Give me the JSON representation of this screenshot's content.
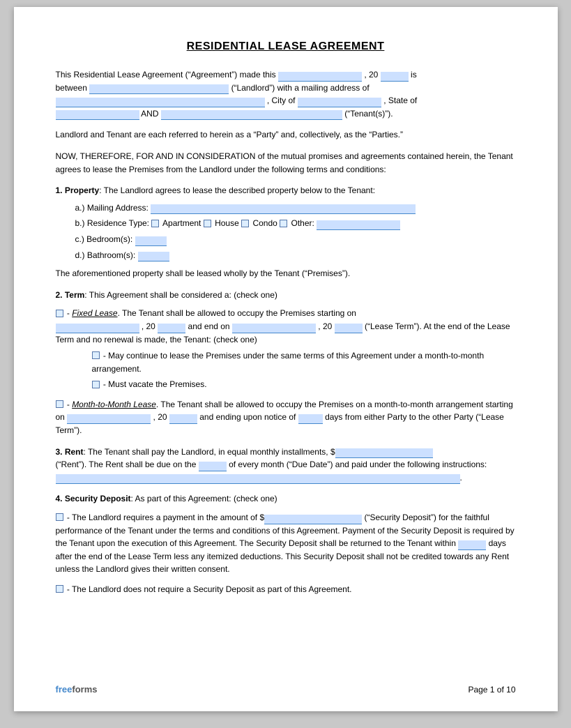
{
  "title": "RESIDENTIAL LEASE AGREEMENT",
  "intro": {
    "line1_pre": "This Residential Lease Agreement (“Agreement”) made this",
    "line1_mid": ", 20",
    "line1_post": "is",
    "line2_pre": "between",
    "line2_mid": "(“Landlord”) with a mailing address of",
    "line3_city_pre": ", City of",
    "line3_post": ", State of",
    "line4_and": "AND",
    "line4_post": "(“Tenant(s)”)."
  },
  "parties_note": "Landlord and Tenant are each referred to herein as a “Party” and, collectively, as the “Parties.”",
  "consideration": "NOW, THEREFORE, FOR AND IN CONSIDERATION of the mutual promises and agreements contained herein, the Tenant agrees to lease the Premises from the Landlord under the following terms and conditions:",
  "section1": {
    "heading": "1. Property",
    "text": ": The Landlord agrees to lease the described property below to the Tenant:",
    "a_label": "a.)  Mailing Address:",
    "b_label": "b.)  Residence Type:",
    "b_options": [
      "Apartment",
      "House",
      "Condo",
      "Other:"
    ],
    "c_label": "c.)  Bedroom(s):",
    "d_label": "d.)  Bathroom(s):",
    "footer_text": "The aforementioned property shall be leased wholly by the Tenant (“Premises”)."
  },
  "section2": {
    "heading": "2. Term",
    "text": ": This Agreement shall be considered a: (check one)",
    "fixed_label": "- ",
    "fixed_italic": "Fixed Lease",
    "fixed_text": ". The Tenant shall be allowed to occupy the Premises starting on",
    "fixed_text2": ", 20",
    "fixed_text3": "and end on",
    "fixed_text4": ", 20",
    "fixed_text5": "(“Lease Term”). At the end of the Lease Term and no renewal is made, the Tenant: (check one)",
    "sub1": "- May continue to lease the Premises under the same terms of this Agreement under a month-to-month arrangement.",
    "sub2": "- Must vacate the Premises.",
    "month_label": "- ",
    "month_italic": "Month-to-Month Lease",
    "month_text": ". The Tenant shall be allowed to occupy the Premises on a month-to-month arrangement starting on",
    "month_text2": ", 20",
    "month_text3": "and ending upon notice of",
    "month_text4": "days from either Party to the other Party (“Lease Term”)."
  },
  "section3": {
    "heading": "3. Rent",
    "text": ": The Tenant shall pay the Landlord, in equal monthly installments, $",
    "text2": "(“Rent”). The Rent shall be due on the",
    "text3": "of every month (“Due Date”) and paid under the following instructions:",
    "line_end": "."
  },
  "section4": {
    "heading": "4. Security Deposit",
    "text": ": As part of this Agreement: (check one)",
    "option1_pre": "- The Landlord requires a payment in the amount of $",
    "option1_post": "(“Security Deposit”) for the faithful performance of the Tenant under the terms and conditions of this Agreement. Payment of the Security Deposit is required by the Tenant upon the execution of this Agreement. The Security Deposit shall be returned to the Tenant within",
    "option1_days": "days after the end of the Lease Term less any itemized deductions. This Security Deposit shall not be credited towards any Rent unless the Landlord gives their written consent.",
    "option2": "- The Landlord does not require a Security Deposit as part of this Agreement."
  },
  "footer": {
    "brand_free": "free",
    "brand_forms": "forms",
    "page": "Page 1 of 10"
  }
}
